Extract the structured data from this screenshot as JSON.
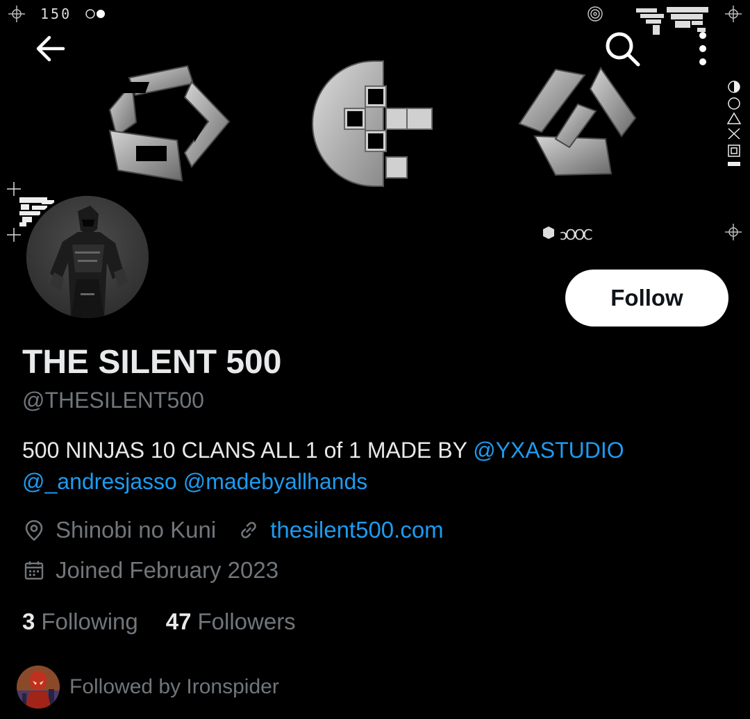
{
  "banner": {
    "code_text": "150",
    "rings_text": "ↄOOC"
  },
  "nav": {
    "back_icon": "arrow-left-icon",
    "search_icon": "search-icon",
    "more_icon": "more-vertical-icon"
  },
  "profile": {
    "display_name": "THE SILENT 500",
    "handle": "@THESILENT500",
    "follow_label": "Follow",
    "bio": {
      "text_part": "500 NINJAS 10 CLANS ALL 1 of 1  MADE BY ",
      "mentions": [
        "@YXASTUDIO",
        "@_andresjasso",
        "@madebyallhands"
      ]
    },
    "location": "Shinobi no Kuni",
    "website": "thesilent500.com",
    "joined": "Joined February 2023",
    "stats": {
      "following_count": "3",
      "following_label": "Following",
      "followers_count": "47",
      "followers_label": "Followers"
    },
    "followed_by": "Followed by Ironspider"
  },
  "colors": {
    "background": "#000000",
    "text_primary": "#e7e9ea",
    "text_secondary": "#71767b",
    "accent": "#1d9bf0",
    "follow_button_bg": "#ffffff"
  }
}
